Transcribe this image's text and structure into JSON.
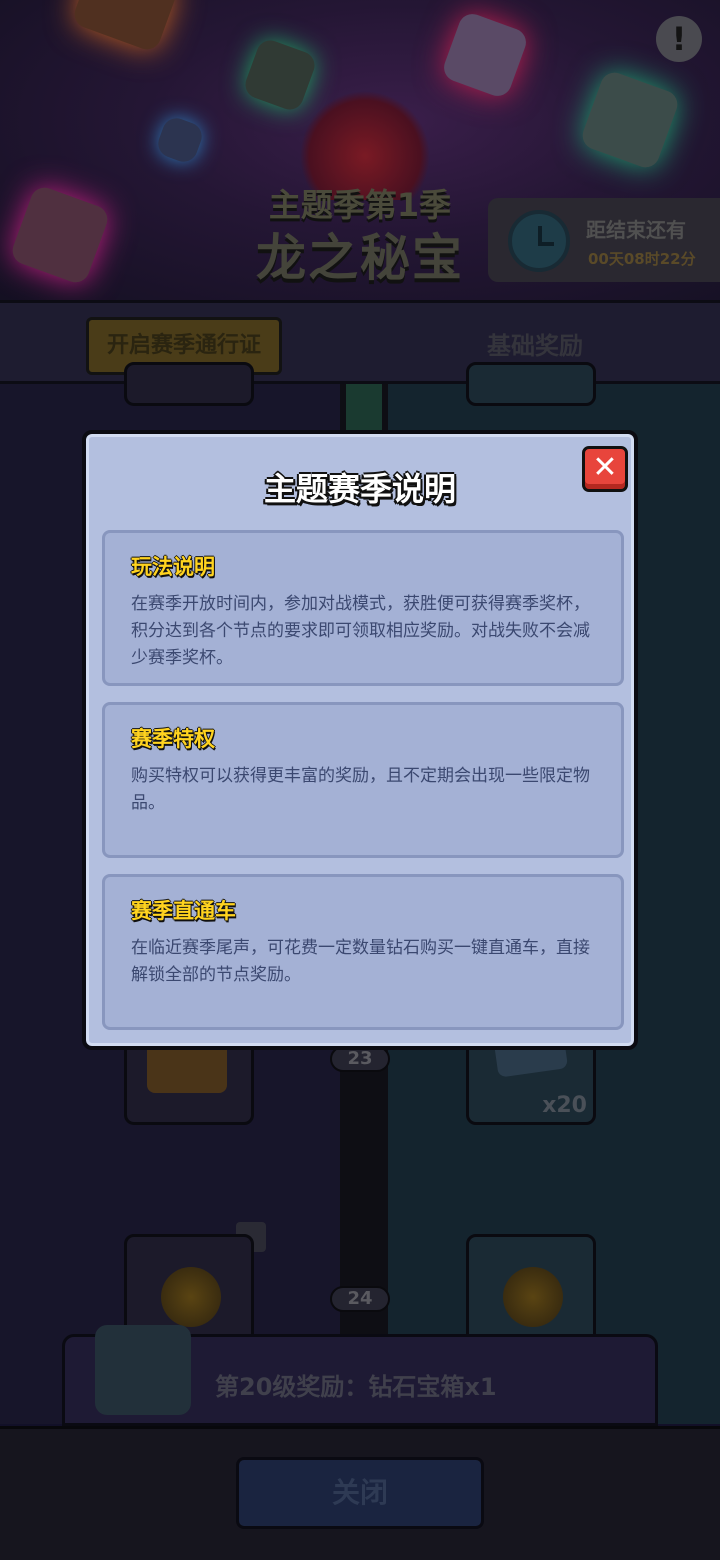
{
  "background": {
    "season_subtitle": "主题季第1季",
    "season_title": "龙之秘宝",
    "help_icon": "exclamation-icon",
    "timer": {
      "label": "距结束还有",
      "value": "00天08时22分"
    },
    "tabs": {
      "premium": "开启赛季通行证",
      "basic": "基础奖励"
    },
    "levels": [
      "23",
      "24"
    ],
    "gem_quantity": "x20",
    "reward_bar_text": "第20级奖励：钻石宝箱x1",
    "close_button": "关闭"
  },
  "modal": {
    "title": "主题赛季说明",
    "close_icon": "close-x-icon",
    "sections": [
      {
        "heading": "玩法说明",
        "body": "在赛季开放时间内，参加对战模式，获胜便可获得赛季奖杯，积分达到各个节点的要求即可领取相应奖励。对战失败不会减少赛季奖杯。"
      },
      {
        "heading": "赛季特权",
        "body": "购买特权可以获得更丰富的奖励，且不定期会出现一些限定物品。"
      },
      {
        "heading": "赛季直通车",
        "body": "在临近赛季尾声，可花费一定数量钻石购买一键直通车，直接解锁全部的节点奖励。"
      }
    ]
  },
  "colors": {
    "modal_bg": "#b3bfdf",
    "section_bg": "#a4b1d5",
    "heading_yellow": "#ffd31f",
    "body_text": "#3b4870",
    "close_red": "#e8453c"
  }
}
